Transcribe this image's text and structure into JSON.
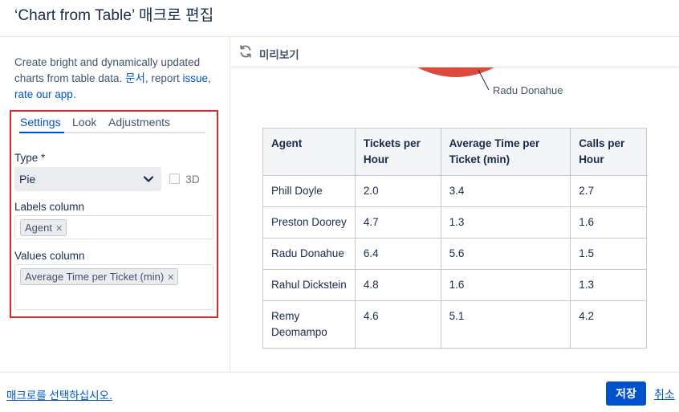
{
  "dialog": {
    "title": "‘Chart from Table’ 매크로 편집"
  },
  "sidebar": {
    "description_text": "Create bright and dynamically updated charts from table data. ",
    "docs_link": "문서",
    "comma": ", report ",
    "issue_link": "issue",
    "separator": ", ",
    "rate_link": "rate our app",
    "period": ".",
    "tabs": [
      {
        "label": "Settings",
        "active": true
      },
      {
        "label": "Look",
        "active": false
      },
      {
        "label": "Adjustments",
        "active": false
      }
    ],
    "type_label": "Type *",
    "type_value": "Pie",
    "checkbox_3d_label": "3D",
    "checkbox_3d_checked": false,
    "labels_column_label": "Labels column",
    "labels_column_tags": [
      "Agent"
    ],
    "values_column_label": "Values column",
    "values_column_tags": [
      "Average Time per Ticket (min)"
    ]
  },
  "preview": {
    "label": "미리보기",
    "pie_slice_label": "Radu Donahue",
    "pie_color": "#d94c3d",
    "table": {
      "headers": [
        "Agent",
        "Tickets per Hour",
        "Average Time per Ticket (min)",
        "Calls per Hour"
      ],
      "rows": [
        [
          "Phill Doyle",
          "2.0",
          "3.4",
          "2.7"
        ],
        [
          "Preston Doorey",
          "4.7",
          "1.3",
          "1.6"
        ],
        [
          "Radu Donahue",
          "6.4",
          "5.6",
          "1.5"
        ],
        [
          "Rahul Dickstein",
          "4.8",
          "1.6",
          "1.3"
        ],
        [
          "Remy Deomampo",
          "4.6",
          "5.1",
          "4.2"
        ]
      ]
    }
  },
  "footer": {
    "hint_link": "매크로를 선택하십시오.",
    "save_label": "저장",
    "cancel_label": "취소"
  },
  "colors": {
    "accent": "#0052cc",
    "highlight_border": "#e0252b"
  }
}
